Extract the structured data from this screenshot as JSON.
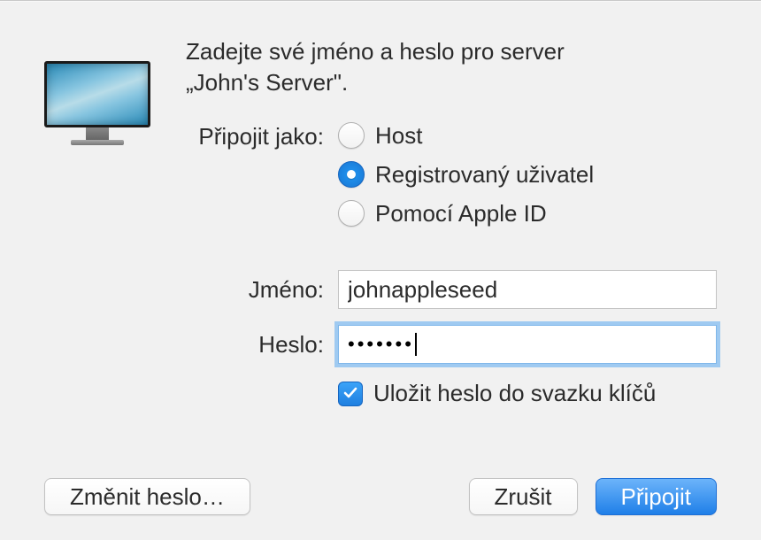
{
  "heading_line1": "Zadejte své jméno a heslo pro server",
  "heading_line2": "„John's Server\".",
  "connect_as_label": "Připojit jako:",
  "radio_options": {
    "guest": "Host",
    "registered": "Registrovaný uživatel",
    "apple_id": "Pomocí Apple ID"
  },
  "selected_option": "registered",
  "name_label": "Jméno:",
  "name_value": "johnappleseed",
  "password_label": "Heslo:",
  "password_masked": "•••••••",
  "remember_label": "Uložit heslo do svazku klíčů",
  "remember_checked": true,
  "buttons": {
    "change_password": "Změnit heslo…",
    "cancel": "Zrušit",
    "connect": "Připojit"
  }
}
